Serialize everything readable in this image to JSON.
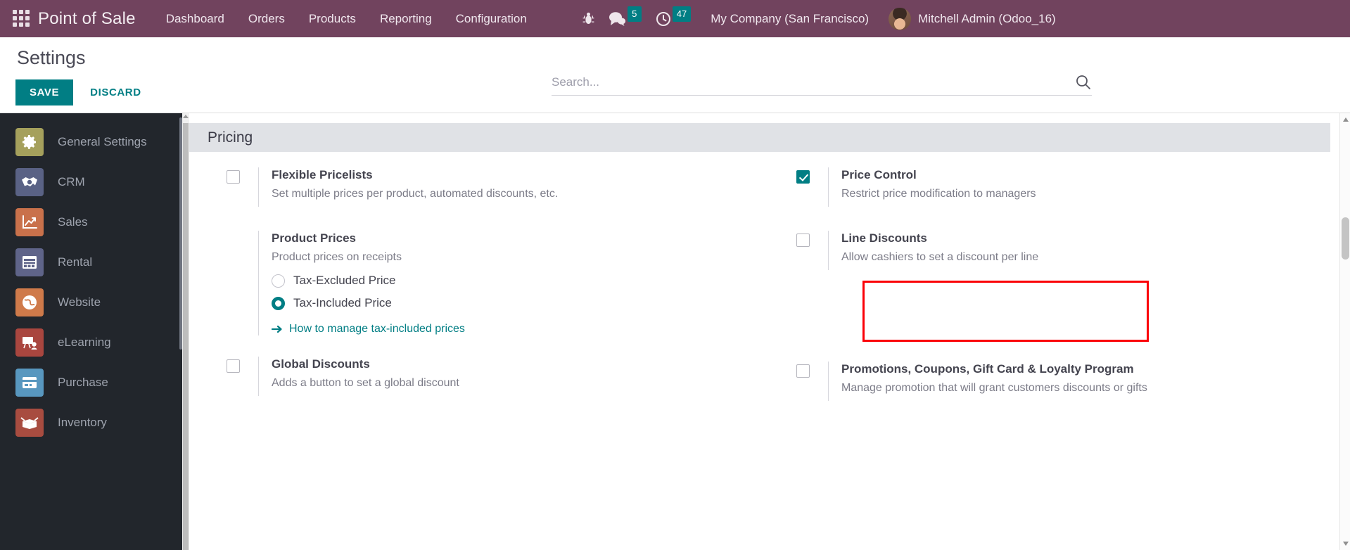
{
  "navbar": {
    "apps_icon": "apps-grid-icon",
    "brand": "Point of Sale",
    "menu": [
      {
        "label": "Dashboard"
      },
      {
        "label": "Orders"
      },
      {
        "label": "Products"
      },
      {
        "label": "Reporting"
      },
      {
        "label": "Configuration"
      }
    ],
    "bug_icon": "bug-icon",
    "messages": {
      "icon": "chat-bubble-icon",
      "count": "5"
    },
    "activities": {
      "icon": "clock-icon",
      "count": "47"
    },
    "company": "My Company (San Francisco)",
    "user": "Mitchell Admin (Odoo_16)",
    "avatar": "user-avatar"
  },
  "control_panel": {
    "title": "Settings",
    "save_label": "SAVE",
    "discard_label": "DISCARD",
    "accent_color": "#017e84"
  },
  "search": {
    "placeholder": "Search...",
    "value": "",
    "icon": "search-icon"
  },
  "sidebar": {
    "items": [
      {
        "label": "General Settings",
        "icon": "gear-icon",
        "color": "#a5a05c"
      },
      {
        "label": "CRM",
        "icon": "handshake-icon",
        "color": "#5a6285"
      },
      {
        "label": "Sales",
        "icon": "chart-up-icon",
        "color": "#c9714b"
      },
      {
        "label": "Rental",
        "icon": "calendar-icon",
        "color": "#5f6489"
      },
      {
        "label": "Website",
        "icon": "globe-icon",
        "color": "#cf7a4a"
      },
      {
        "label": "eLearning",
        "icon": "presentation-icon",
        "color": "#a9463f"
      },
      {
        "label": "Purchase",
        "icon": "credit-card-icon",
        "color": "#5897bf"
      },
      {
        "label": "Inventory",
        "icon": "box-icon",
        "color": "#a84c40"
      }
    ]
  },
  "settings": {
    "section_title": "Pricing",
    "left_column": [
      {
        "name": "flexible-pricelists",
        "title": "Flexible Pricelists",
        "desc": "Set multiple prices per product, automated discounts, etc.",
        "control": "checkbox",
        "checked": false
      },
      {
        "name": "product-prices",
        "title": "Product Prices",
        "desc": "Product prices on receipts",
        "control": "none",
        "radios": [
          {
            "label": "Tax-Excluded Price",
            "selected": false
          },
          {
            "label": "Tax-Included Price",
            "selected": true
          }
        ],
        "link": {
          "label": "How to manage tax-included prices",
          "icon": "arrow-right-icon"
        }
      },
      {
        "name": "global-discounts",
        "title": "Global Discounts",
        "desc": "Adds a button to set a global discount",
        "control": "checkbox",
        "checked": false
      }
    ],
    "right_column": [
      {
        "name": "price-control",
        "title": "Price Control",
        "desc": "Restrict price modification to managers",
        "control": "checkbox",
        "checked": true,
        "highlighted": true
      },
      {
        "name": "line-discounts",
        "title": "Line Discounts",
        "desc": "Allow cashiers to set a discount per line",
        "control": "checkbox",
        "checked": false
      },
      {
        "name": "promotions-coupons-loyalty",
        "title": "Promotions, Coupons, Gift Card & Loyalty Program",
        "desc": "Manage promotion that will grant customers discounts or gifts",
        "control": "checkbox",
        "checked": false
      }
    ],
    "highlight_color": "#fb0007"
  }
}
